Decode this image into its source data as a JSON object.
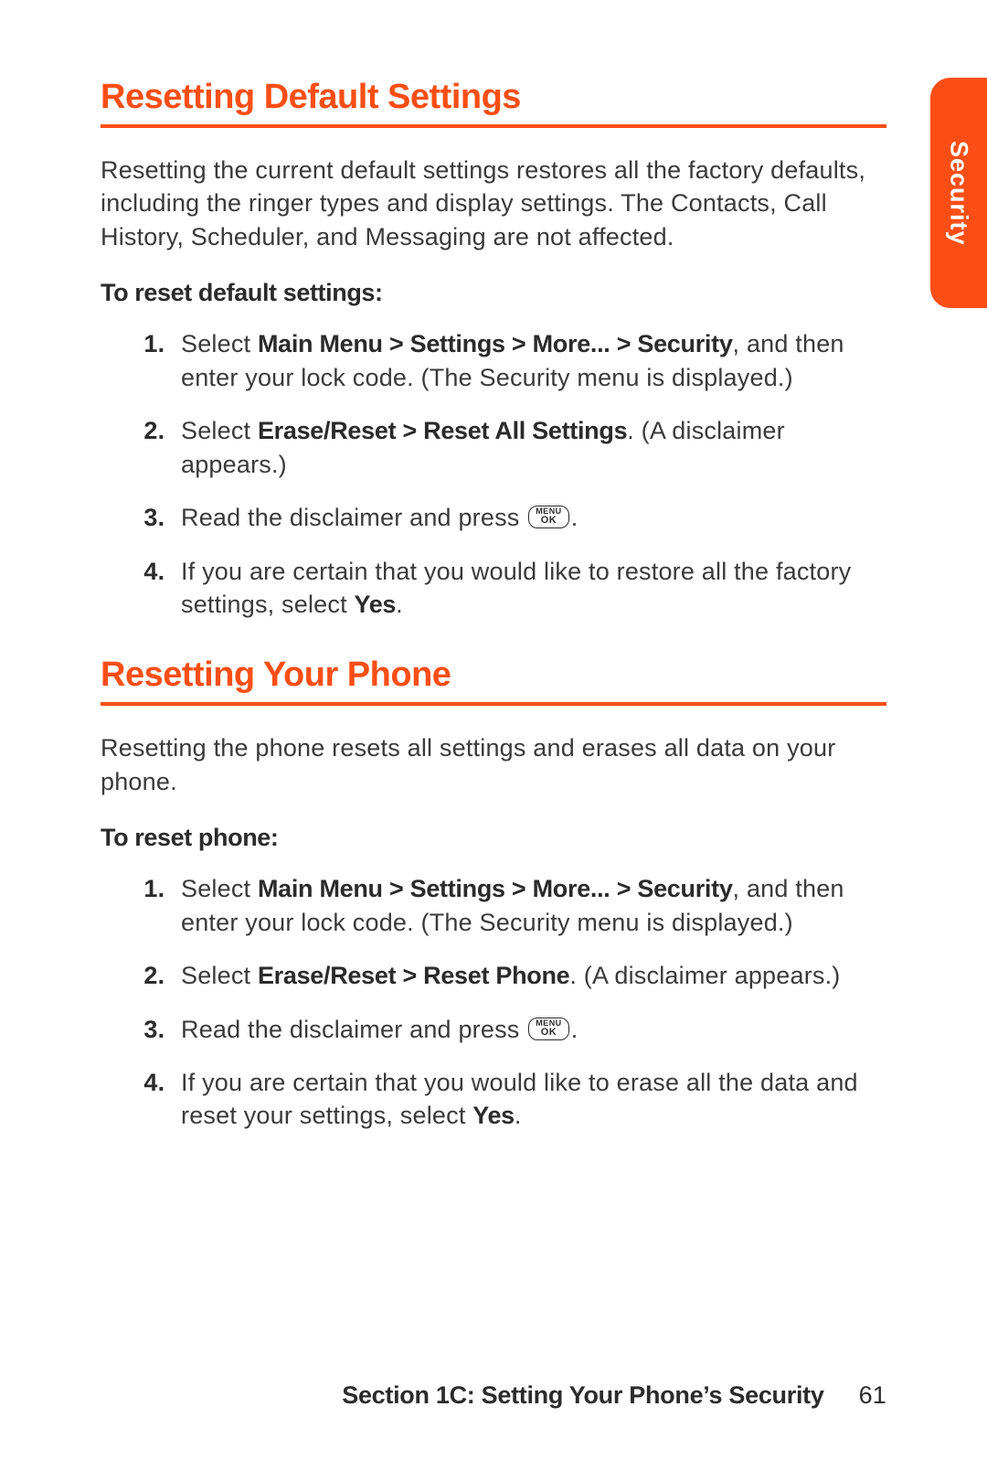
{
  "colors": {
    "accent": "#fa4e15"
  },
  "sideTab": {
    "label": "Security"
  },
  "section1": {
    "heading": "Resetting Default Settings",
    "intro": "Resetting the current default settings restores all the factory defaults, including the ringer types and display settings. The Contacts, Call History, Scheduler, and Messaging are not affected.",
    "subhead": "To reset default settings:",
    "steps": {
      "s1": {
        "a": "Select ",
        "b": "Main Menu > Settings > More... > Security",
        "c": ", and then enter your lock code. (The Security menu is displayed.)"
      },
      "s2": {
        "a": "Select ",
        "b": "Erase/Reset > Reset All Settings",
        "c": ". (A disclaimer appears.)"
      },
      "s3": {
        "a": "Read the disclaimer and press ",
        "key": {
          "l1": "MENU",
          "l2": "OK"
        },
        "c": "."
      },
      "s4": {
        "a": "If you are certain that you would like to restore all the factory settings, select ",
        "b": "Yes",
        "c": "."
      }
    }
  },
  "section2": {
    "heading": "Resetting Your Phone",
    "intro": "Resetting the phone resets all settings and erases all data on your phone.",
    "subhead": "To reset phone:",
    "steps": {
      "s1": {
        "a": "Select ",
        "b": "Main Menu > Settings > More... > Security",
        "c": ", and then enter your lock code. (The Security menu is displayed.)"
      },
      "s2": {
        "a": "Select ",
        "b": "Erase/Reset > Reset Phone",
        "c": ". (A disclaimer appears.)"
      },
      "s3": {
        "a": "Read the disclaimer and press ",
        "key": {
          "l1": "MENU",
          "l2": "OK"
        },
        "c": "."
      },
      "s4": {
        "a": "If you are certain that you would like to erase all the data and reset your settings, select ",
        "b": "Yes",
        "c": "."
      }
    }
  },
  "footer": {
    "title": "Section 1C: Setting Your Phone’s Security",
    "page": "61"
  }
}
